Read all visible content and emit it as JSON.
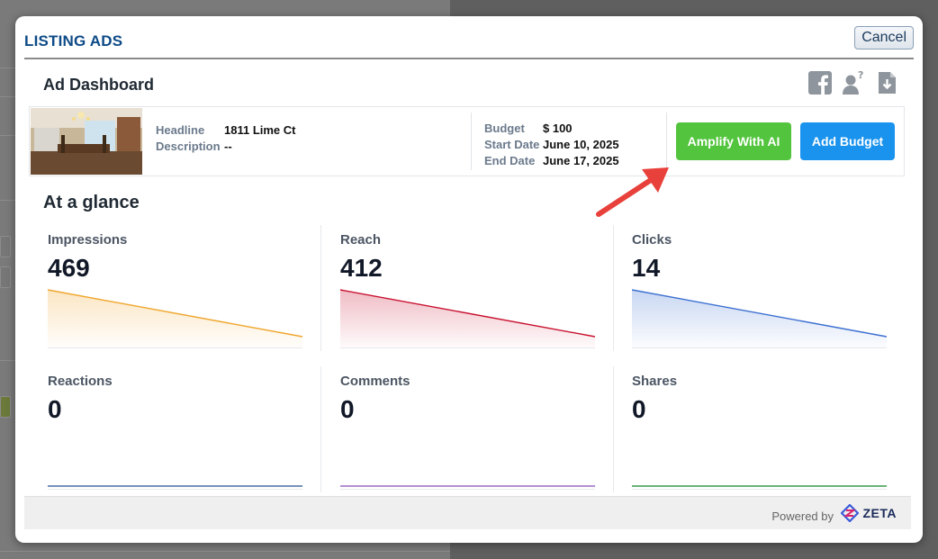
{
  "modal": {
    "title": "LISTING ADS",
    "cancel_label": "Cancel"
  },
  "dashboard": {
    "title": "Ad Dashboard",
    "icons": [
      "facebook-icon",
      "user-help-icon",
      "download-icon"
    ]
  },
  "ad": {
    "headline_label": "Headline",
    "headline_value": "1811 Lime Ct",
    "description_label": "Description",
    "description_value": "--",
    "budget_label": "Budget",
    "budget_value": "$ 100",
    "start_label": "Start Date",
    "start_value": "June 10, 2025",
    "end_label": "End Date",
    "end_value": "June 17, 2025",
    "amplify_label": "Amplify With AI",
    "add_budget_label": "Add Budget"
  },
  "glance": {
    "title": "At a glance",
    "metrics": [
      {
        "label": "Impressions",
        "value": "469",
        "color": "#f0a52a",
        "trend": "down"
      },
      {
        "label": "Reach",
        "value": "412",
        "color": "#c8102e",
        "trend": "down"
      },
      {
        "label": "Clicks",
        "value": "14",
        "color": "#3c6fd1",
        "trend": "down"
      },
      {
        "label": "Reactions",
        "value": "0",
        "color": "#4a6fa5",
        "trend": "flat"
      },
      {
        "label": "Comments",
        "value": "0",
        "color": "#9b6bc4",
        "trend": "flat"
      },
      {
        "label": "Shares",
        "value": "0",
        "color": "#3a9a4a",
        "trend": "flat"
      }
    ]
  },
  "footer": {
    "powered_by": "Powered by",
    "brand": "ZETA"
  },
  "colors": {
    "title_blue": "#0d4a86",
    "amplify_green": "#53c43d",
    "budget_blue": "#1a93ee",
    "annotation_arrow": "#e8403a"
  }
}
